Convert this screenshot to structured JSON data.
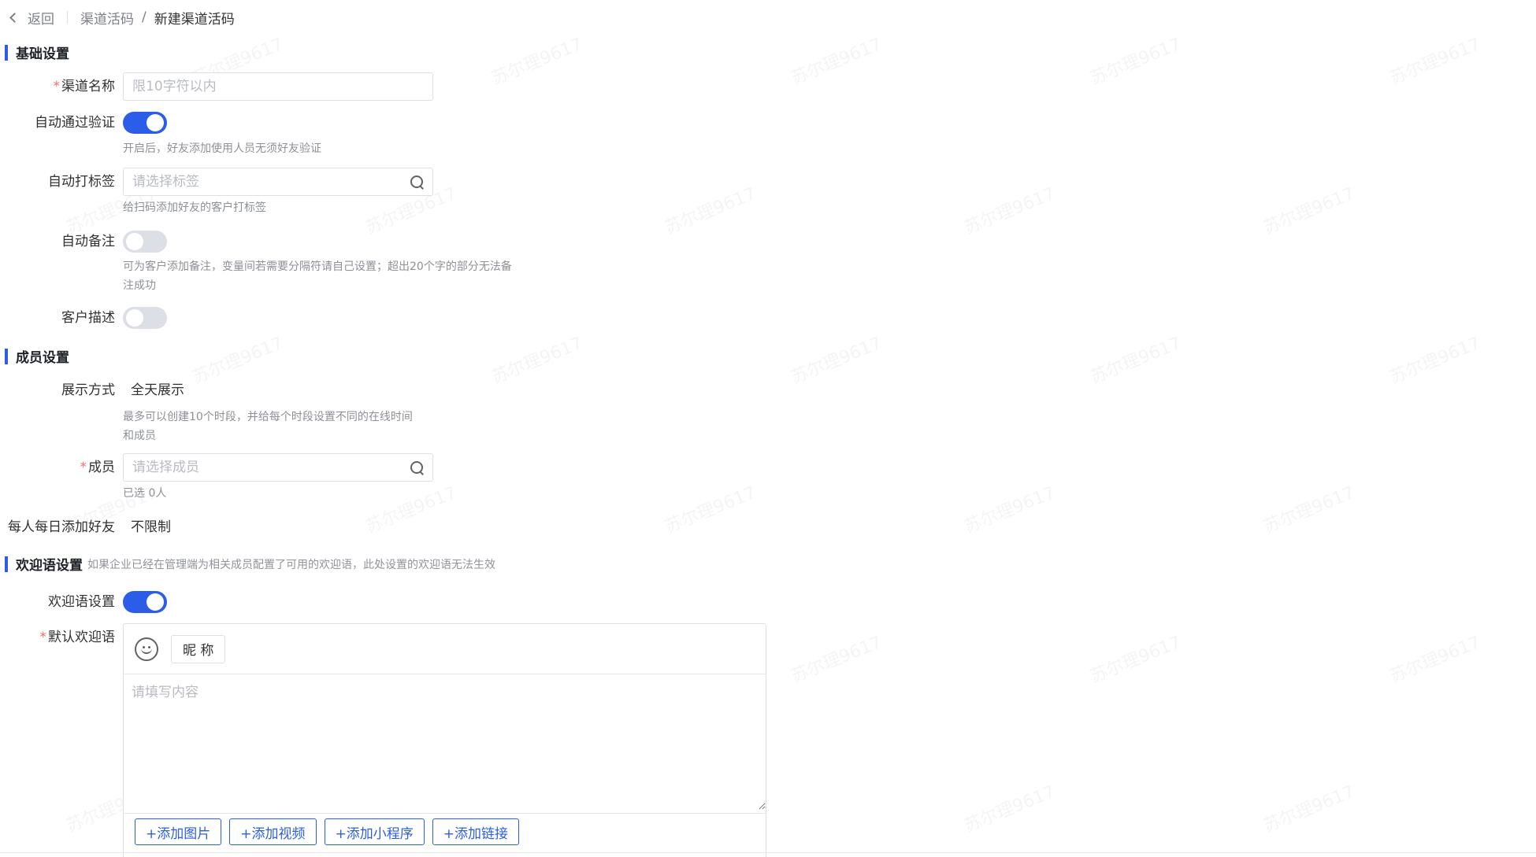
{
  "breadcrumb": {
    "back_label": "返回",
    "parent": "渠道活码",
    "separator": "/",
    "current": "新建渠道活码"
  },
  "watermark": {
    "text": "苏尔理9617"
  },
  "sections": {
    "basic": "基础设置",
    "members": "成员设置",
    "welcome": "欢迎语设置",
    "welcome_note": "如果企业已经在管理端为相关成员配置了可用的欢迎语，此处设置的欢迎语无法生效"
  },
  "required_mark": "*",
  "basic": {
    "channel_name_label": "渠道名称",
    "channel_name_placeholder": "限10字符以内",
    "auto_verify_label": "自动通过验证",
    "auto_verify_on": true,
    "auto_verify_hint": "开启后，好友添加使用人员无须好友验证",
    "auto_tag_label": "自动打标签",
    "auto_tag_placeholder": "请选择标签",
    "auto_tag_hint": "给扫码添加好友的客户打标签",
    "auto_remark_label": "自动备注",
    "auto_remark_on": false,
    "auto_remark_hint_line1": "可为客户添加备注，变量间若需要分隔符请自己设置；超出20个字的部分无法备",
    "auto_remark_hint_line2": "注成功",
    "customer_desc_label": "客户描述",
    "customer_desc_on": false
  },
  "members": {
    "display_mode_label": "展示方式",
    "display_mode_value": "全天展示",
    "display_mode_hint_line1": "最多可以创建10个时段，并给每个时段设置不同的在线时间",
    "display_mode_hint_line2": "和成员",
    "member_label": "成员",
    "member_placeholder": "请选择成员",
    "member_selected": "已选 0人",
    "daily_limit_label": "每人每日添加好友",
    "daily_limit_value": "不限制"
  },
  "welcome": {
    "toggle_label": "欢迎语设置",
    "toggle_on": true,
    "default_label": "默认欢迎语",
    "nickname_button": "昵 称",
    "content_placeholder": "请填写内容",
    "add_image": "+添加图片",
    "add_video": "+添加视频",
    "add_miniprogram": "+添加小程序",
    "add_link": "+添加链接"
  },
  "colors": {
    "accent": "#2b5de8",
    "required": "#f56c6c",
    "switch_off": "#dcdfe6"
  }
}
